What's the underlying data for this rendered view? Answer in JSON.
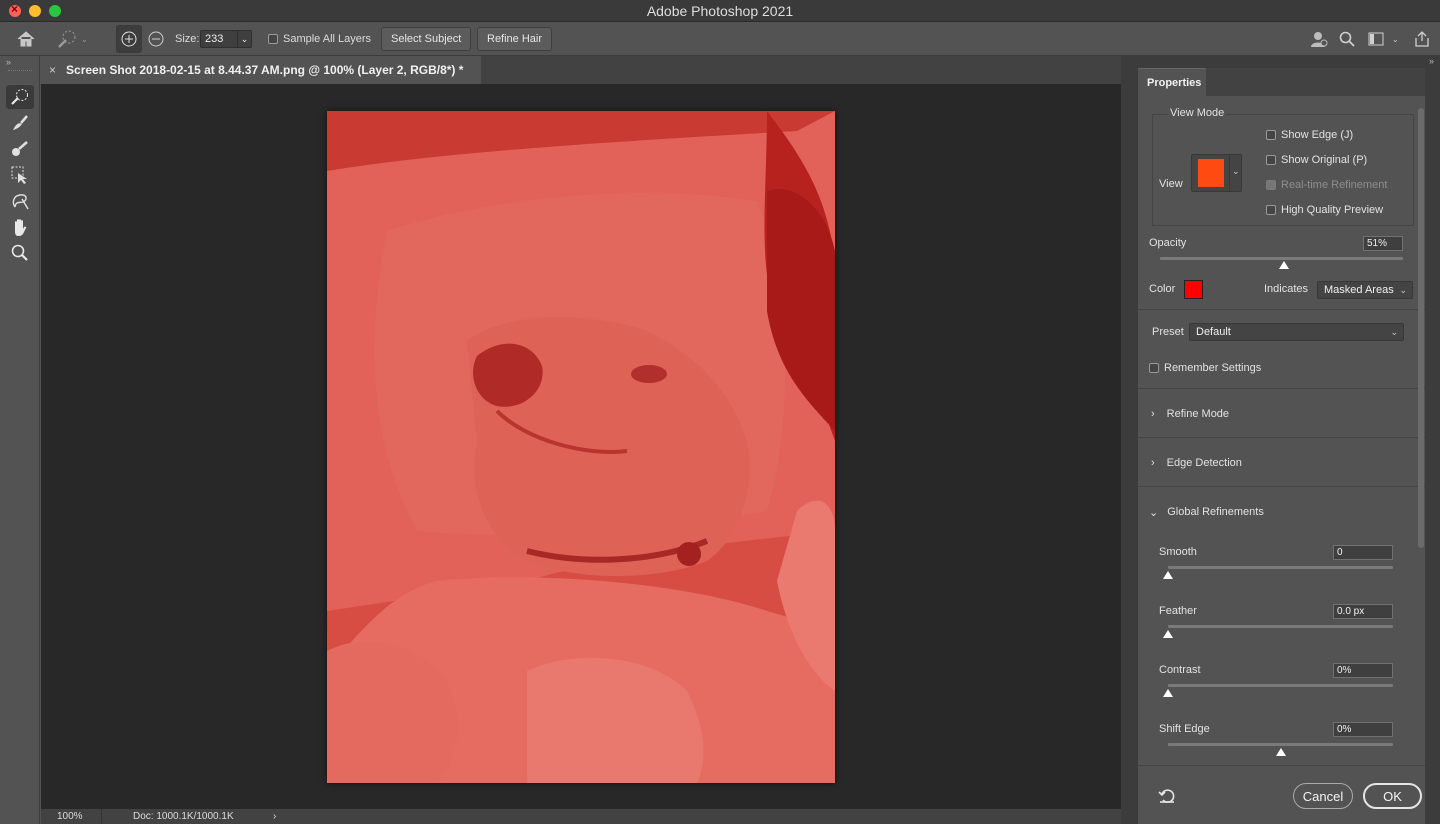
{
  "app": {
    "title": "Adobe Photoshop 2021"
  },
  "options_bar": {
    "size_label": "Size:",
    "size_value": "233",
    "sample_all_layers": "Sample All Layers",
    "select_subject": "Select Subject",
    "refine_hair": "Refine Hair"
  },
  "document": {
    "tab_title": "Screen Shot 2018-02-15 at 8.44.37 AM.png @ 100% (Layer 2, RGB/8*) *",
    "zoom": "100%",
    "doc_info": "Doc: 1000.1K/1000.1K"
  },
  "properties": {
    "tab_label": "Properties",
    "view_mode": {
      "heading": "View Mode",
      "view_label": "View",
      "swatch_color": "#ff4a12",
      "show_edge": "Show Edge (J)",
      "show_original": "Show Original (P)",
      "realtime": "Real-time Refinement",
      "high_quality": "High Quality Preview"
    },
    "opacity": {
      "label": "Opacity",
      "value": "51%",
      "level": 0.51
    },
    "color": {
      "label": "Color",
      "swatch": "#ff0000"
    },
    "indicates": {
      "label": "Indicates",
      "value": "Masked Areas"
    },
    "preset": {
      "label": "Preset",
      "value": "Default"
    },
    "remember": "Remember Settings",
    "sections": {
      "refine_mode": "Refine Mode",
      "edge_detection": "Edge Detection",
      "global_refinements": "Global Refinements"
    },
    "sliders": [
      {
        "label": "Smooth",
        "value": "0",
        "level": 0.0
      },
      {
        "label": "Feather",
        "value": "0.0 px",
        "level": 0.0
      },
      {
        "label": "Contrast",
        "value": "0%",
        "level": 0.0
      },
      {
        "label": "Shift Edge",
        "value": "0%",
        "level": 0.5
      }
    ],
    "cancel": "Cancel",
    "ok": "OK"
  },
  "colors": {
    "overlay": "#d94f45",
    "accent_swatch": "#ff4a12"
  }
}
